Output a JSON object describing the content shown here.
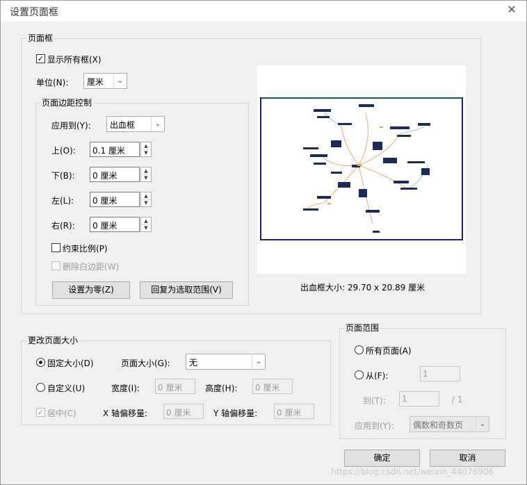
{
  "dialog": {
    "title": "设置页面框",
    "close_icon": "close-icon"
  },
  "page_boxes": {
    "legend": "页面框",
    "show_all_boxes": {
      "label": "显示所有框(X)",
      "checked": true
    },
    "unit": {
      "label": "单位(N):",
      "value": "厘米"
    },
    "margin_controls": {
      "legend": "页面边距控制",
      "apply_to": {
        "label": "应用到(Y):",
        "value": "出血框"
      },
      "top": {
        "label": "上(O):",
        "value": "0.1 厘米"
      },
      "bottom": {
        "label": "下(B):",
        "value": "0 厘米"
      },
      "left": {
        "label": "左(L):",
        "value": "0 厘米"
      },
      "right": {
        "label": "右(R):",
        "value": "0 厘米"
      },
      "constrain_proportions": {
        "label": "约束比例(P)",
        "checked": false
      },
      "remove_white_margins": {
        "label": "删除白边距(W)",
        "checked": false,
        "enabled": false
      },
      "set_to_zero": "设置为零(Z)",
      "revert_to_selection": "回复为选取范围(V)"
    },
    "preview": {
      "size_caption": "出血框大小:  29.70 x 20.89 厘米"
    }
  },
  "change_page_size": {
    "legend": "更改页面大小",
    "fixed_size": {
      "label": "固定大小(D)",
      "selected": true
    },
    "page_size": {
      "label": "页面大小(G):",
      "value": "无"
    },
    "custom": {
      "label": "自定义(U)",
      "selected": false
    },
    "width": {
      "label": "宽度(I):",
      "value": "0 厘米"
    },
    "height": {
      "label": "高度(H):",
      "value": "0 厘米"
    },
    "center": {
      "label": "居中(C)",
      "checked": true,
      "enabled": false
    },
    "x_offset": {
      "label": "X 轴偏移量:",
      "value": "0 厘米"
    },
    "y_offset": {
      "label": "Y 轴偏移量:",
      "value": "0 厘米"
    }
  },
  "page_range": {
    "legend": "页面范围",
    "all_pages": {
      "label": "所有页面(A)",
      "selected": false
    },
    "from": {
      "label": "从(F):",
      "value": "1",
      "selected": false
    },
    "to": {
      "label": "到(T):",
      "value": "1",
      "total": "/ 1"
    },
    "apply_to": {
      "label": "应用到(Y):",
      "value": "偶数和奇数页"
    }
  },
  "footer": {
    "ok": "确定",
    "cancel": "取消",
    "watermark": "https://blog.csdn.net/weixin_44076906"
  }
}
